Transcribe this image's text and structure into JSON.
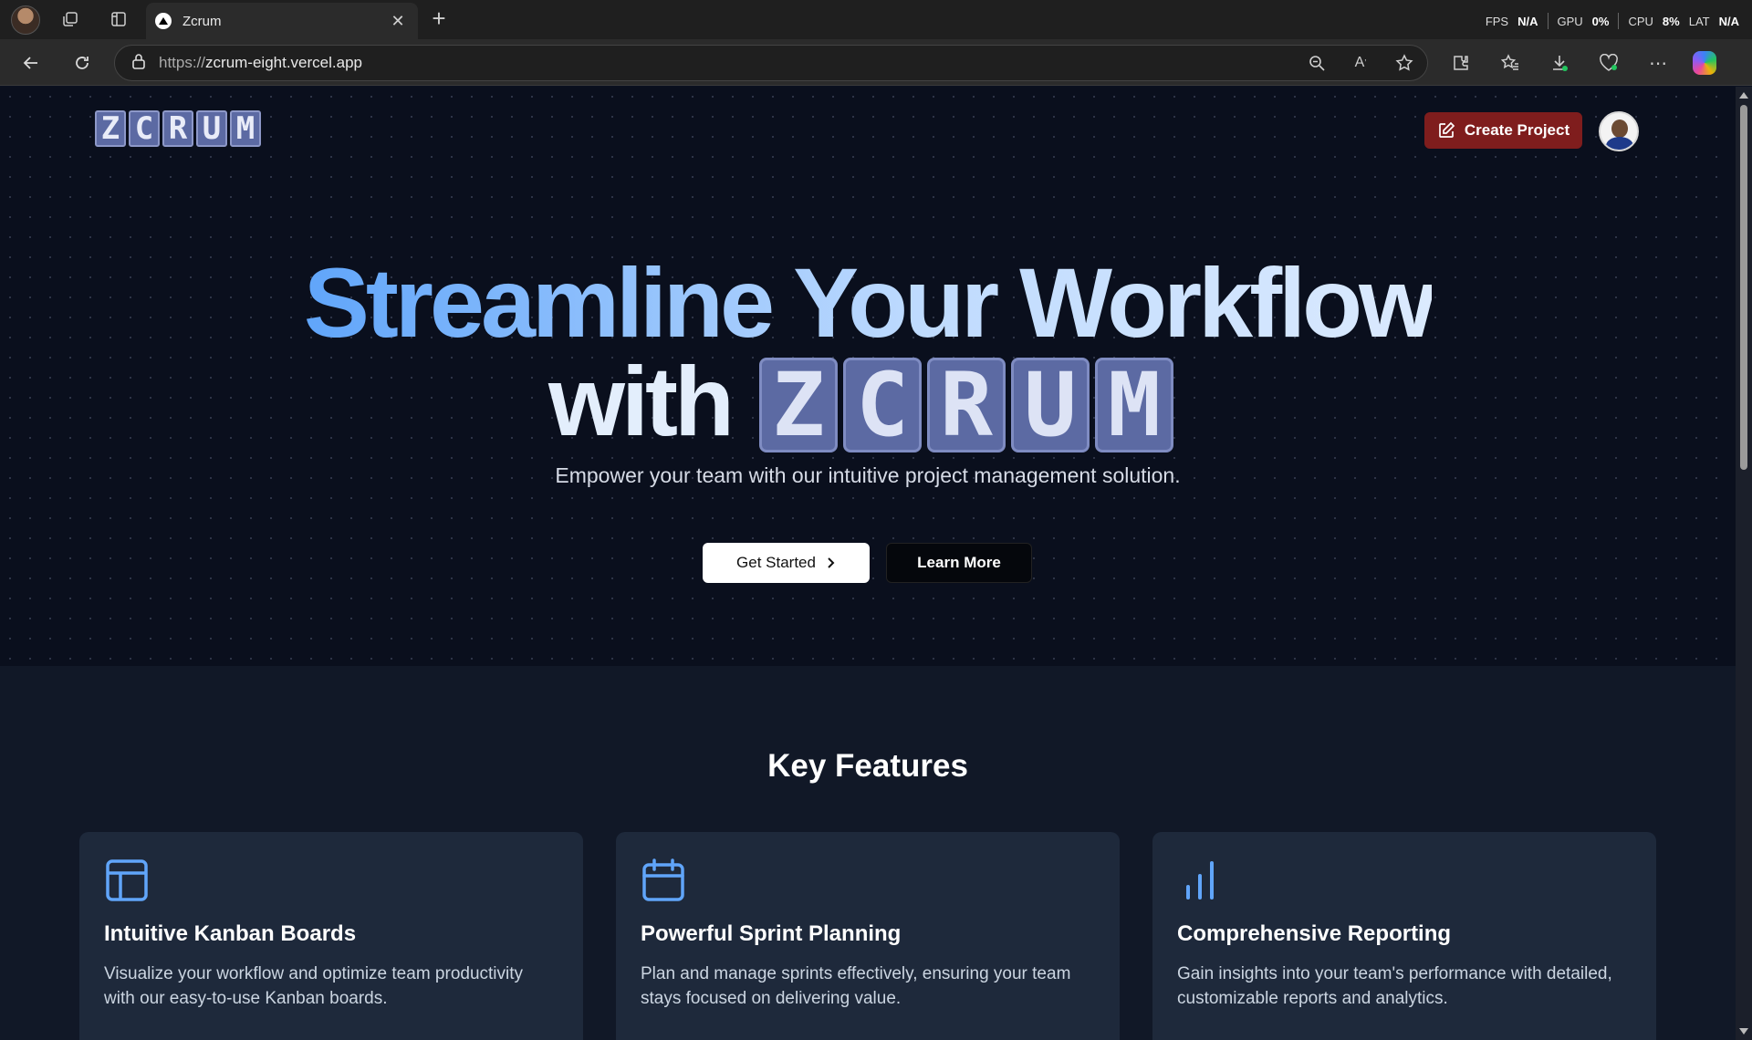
{
  "browser": {
    "tab_title": "Zcrum",
    "url_prefix": "https://",
    "url_host": "zcrum-eight.vercel.app",
    "perf": {
      "fps_label": "FPS",
      "fps_value": "N/A",
      "gpu_label": "GPU",
      "gpu_value": "0%",
      "cpu_label": "CPU",
      "cpu_value": "8%",
      "lat_label": "LAT",
      "lat_value": "N/A"
    }
  },
  "nav": {
    "logo_letters": [
      "Z",
      "C",
      "R",
      "U",
      "M"
    ],
    "create_project_label": "Create Project"
  },
  "hero": {
    "headline_line1": "Streamline Your Workflow",
    "headline_with": "with",
    "logo_letters": [
      "Z",
      "C",
      "R",
      "U",
      "M"
    ],
    "subtitle": "Empower your team with our intuitive project management solution.",
    "get_started_label": "Get Started",
    "learn_more_label": "Learn More"
  },
  "features": {
    "title": "Key Features",
    "cards": [
      {
        "icon": "layout-icon",
        "title": "Intuitive Kanban Boards",
        "desc": "Visualize your workflow and optimize team productivity with our easy-to-use Kanban boards."
      },
      {
        "icon": "calendar-icon",
        "title": "Powerful Sprint Planning",
        "desc": "Plan and manage sprints effectively, ensuring your team stays focused on delivering value."
      },
      {
        "icon": "bar-chart-icon",
        "title": "Comprehensive Reporting",
        "desc": "Gain insights into your team's performance with detailed, customizable reports and analytics."
      }
    ]
  },
  "colors": {
    "accent_red": "#7f1d1d",
    "logo_tile": "#5c6aa3",
    "feature_icon": "#60a5fa"
  }
}
